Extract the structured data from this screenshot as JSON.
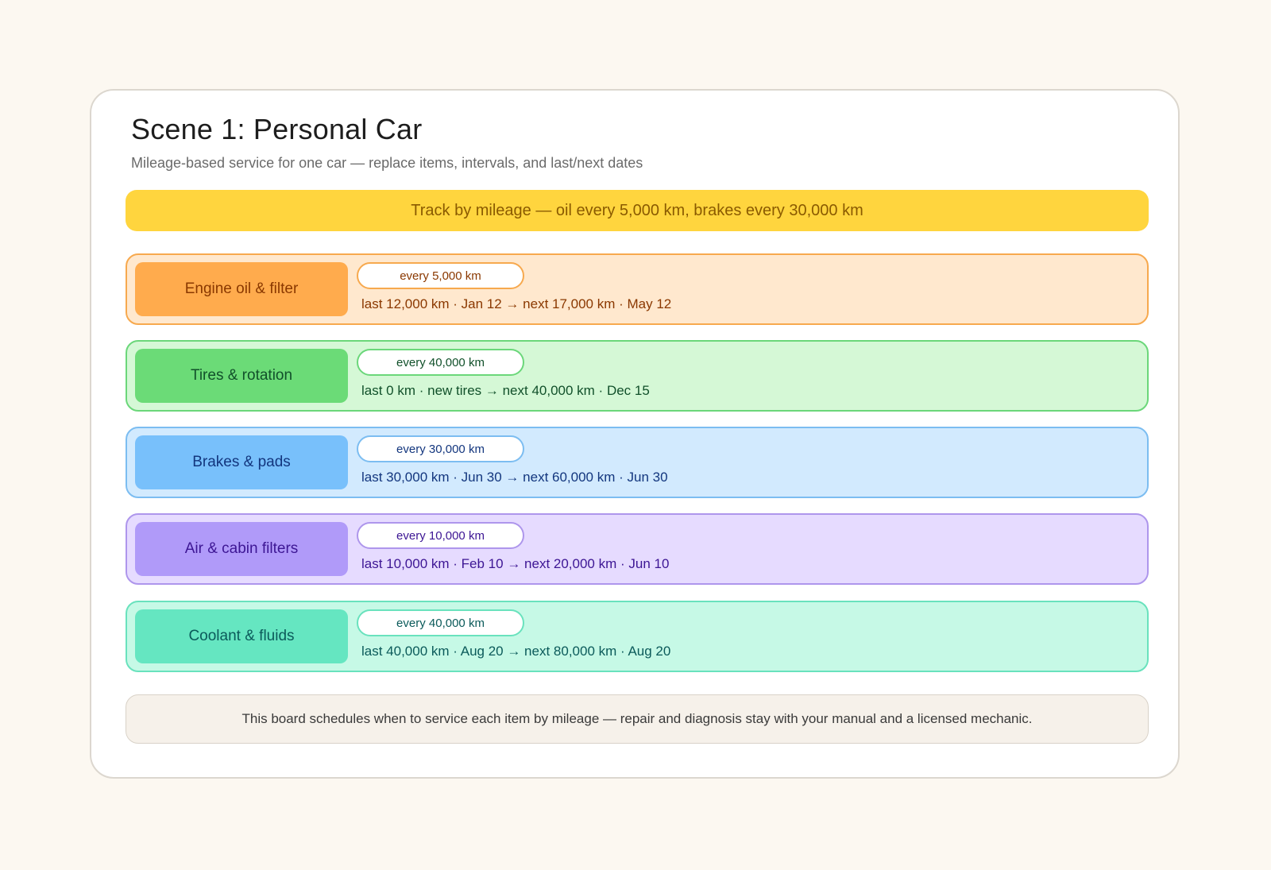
{
  "header": {
    "title": "Scene 1: Personal Car",
    "subtitle": "Mileage-based service for one car — replace items, intervals, and last/next dates"
  },
  "banner": {
    "text": "Track by mileage — oil every 5,000 km, brakes every 30,000 km",
    "color": "#ffd53e"
  },
  "items": [
    {
      "label": "Engine oil & filter",
      "interval": "every 5,000 km",
      "detail": "last 12,000 km · Jan 12 → next 17,000 km · May 12",
      "color": "#ffab4d"
    },
    {
      "label": "Tires & rotation",
      "interval": "every 40,000 km",
      "detail": "last 0 km · new tires → next 40,000 km · Dec 15",
      "color": "#6bdb77"
    },
    {
      "label": "Brakes & pads",
      "interval": "every 30,000 km",
      "detail": "last 30,000 km · Jun 30 → next 60,000 km · Jun 30",
      "color": "#78c0fb"
    },
    {
      "label": "Air & cabin filters",
      "interval": "every 10,000 km",
      "detail": "last 10,000 km · Feb 10 → next 20,000 km · Jun 10",
      "color": "#b09af9"
    },
    {
      "label": "Coolant & fluids",
      "interval": "every 40,000 km",
      "detail": "last 40,000 km · Aug 20 → next 80,000 km · Aug 20",
      "color": "#65e6c1"
    }
  ],
  "footer": {
    "text": "This board schedules when to service each item by mileage — repair and diagnosis stay with your manual and a licensed mechanic."
  }
}
